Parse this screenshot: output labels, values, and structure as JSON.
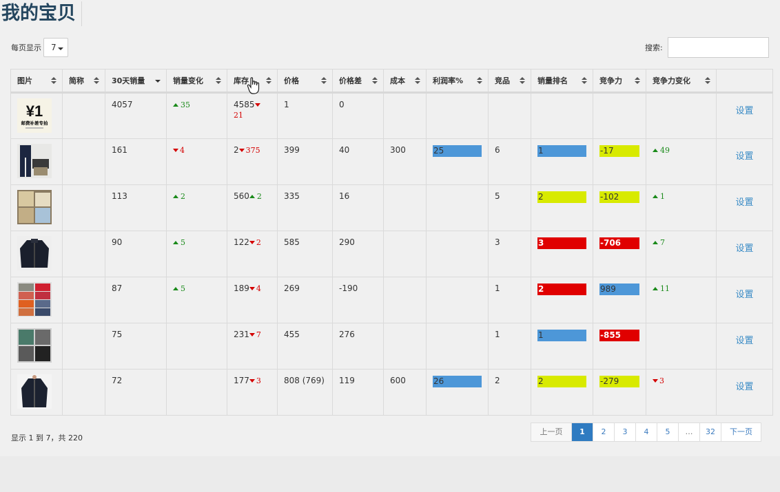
{
  "page": {
    "title": "我的宝贝"
  },
  "controls": {
    "length_label": "每页显示",
    "length_value": "7",
    "search_label": "搜索:",
    "search_value": ""
  },
  "table": {
    "columns": [
      "图片",
      "简称",
      "30天销量",
      "销量变化",
      "库存",
      "价格",
      "价格差",
      "成本",
      "利润率%",
      "竞品",
      "销量排名",
      "竞争力",
      "竞争力变化",
      ""
    ],
    "sorted_column": "30天销量",
    "action_label": "设置",
    "rows": [
      {
        "thumb": "coupon",
        "name": "",
        "sales": "4057",
        "sales_change": {
          "dir": "up",
          "value": "35"
        },
        "stock": "4585",
        "stock_change": {
          "dir": "down",
          "value": "21"
        },
        "price": "1",
        "price_diff": "0",
        "cost": "",
        "profit": null,
        "competitors": "",
        "rank": null,
        "compete": null,
        "compete_change": null
      },
      {
        "thumb": "pants",
        "name": "",
        "sales": "161",
        "sales_change": {
          "dir": "down",
          "value": "4"
        },
        "stock": "2",
        "stock_change": {
          "dir": "down",
          "value": "375"
        },
        "price": "399",
        "price_diff": "40",
        "cost": "300",
        "profit": {
          "value": "25",
          "color": "blue"
        },
        "competitors": "6",
        "rank": {
          "value": "1",
          "color": "blue"
        },
        "compete": {
          "value": "-17",
          "color": "yellow"
        },
        "compete_change": {
          "dir": "up",
          "value": "49"
        }
      },
      {
        "thumb": "khaki",
        "name": "",
        "sales": "113",
        "sales_change": {
          "dir": "up",
          "value": "2"
        },
        "stock": "560",
        "stock_change": {
          "dir": "up",
          "value": "2"
        },
        "price": "335",
        "price_diff": "16",
        "cost": "",
        "profit": null,
        "competitors": "5",
        "rank": {
          "value": "2",
          "color": "yellow"
        },
        "compete": {
          "value": "-102",
          "color": "yellow"
        },
        "compete_change": {
          "dir": "up",
          "value": "1"
        }
      },
      {
        "thumb": "jacket",
        "name": "",
        "sales": "90",
        "sales_change": {
          "dir": "up",
          "value": "5"
        },
        "stock": "122",
        "stock_change": {
          "dir": "down",
          "value": "2"
        },
        "price": "585",
        "price_diff": "290",
        "cost": "",
        "profit": null,
        "competitors": "3",
        "rank": {
          "value": "3",
          "color": "red"
        },
        "compete": {
          "value": "-706",
          "color": "red"
        },
        "compete_change": {
          "dir": "up",
          "value": "7"
        }
      },
      {
        "thumb": "grid",
        "name": "",
        "sales": "87",
        "sales_change": {
          "dir": "up",
          "value": "5"
        },
        "stock": "189",
        "stock_change": {
          "dir": "down",
          "value": "4"
        },
        "price": "269",
        "price_diff": "-190",
        "cost": "",
        "profit": null,
        "competitors": "1",
        "rank": {
          "value": "2",
          "color": "red"
        },
        "compete": {
          "value": "989",
          "color": "blue"
        },
        "compete_change": {
          "dir": "up",
          "value": "11"
        }
      },
      {
        "thumb": "shirts",
        "name": "",
        "sales": "75",
        "sales_change": null,
        "stock": "231",
        "stock_change": {
          "dir": "down",
          "value": "7"
        },
        "price": "455",
        "price_diff": "276",
        "cost": "",
        "profit": null,
        "competitors": "1",
        "rank": {
          "value": "1",
          "color": "blue"
        },
        "compete": {
          "value": "-855",
          "color": "red"
        },
        "compete_change": null
      },
      {
        "thumb": "coat",
        "name": "",
        "sales": "72",
        "sales_change": null,
        "stock": "177",
        "stock_change": {
          "dir": "down",
          "value": "3"
        },
        "price": "808 (769)",
        "price_diff": "119",
        "cost": "600",
        "profit": {
          "value": "26",
          "color": "blue"
        },
        "competitors": "2",
        "rank": {
          "value": "2",
          "color": "yellow"
        },
        "compete": {
          "value": "-279",
          "color": "yellow"
        },
        "compete_change": {
          "dir": "down",
          "value": "3"
        }
      }
    ]
  },
  "coupon_thumb": {
    "big": "¥1",
    "line1": "邮费补差专拍",
    "line2": ""
  },
  "footer": {
    "info": "显示 1 到 7，共 220",
    "prev": "上一页",
    "next": "下一页",
    "pages": [
      "1",
      "2",
      "3",
      "4",
      "5",
      "…",
      "32"
    ],
    "active_page": "1"
  },
  "colors": {
    "blue": "#4d97d8",
    "yellow": "#d8ea00",
    "red": "#e00000",
    "up": "#1a8a1a",
    "down": "#d40000",
    "link": "#3b8cc6",
    "title": "#24465f"
  }
}
